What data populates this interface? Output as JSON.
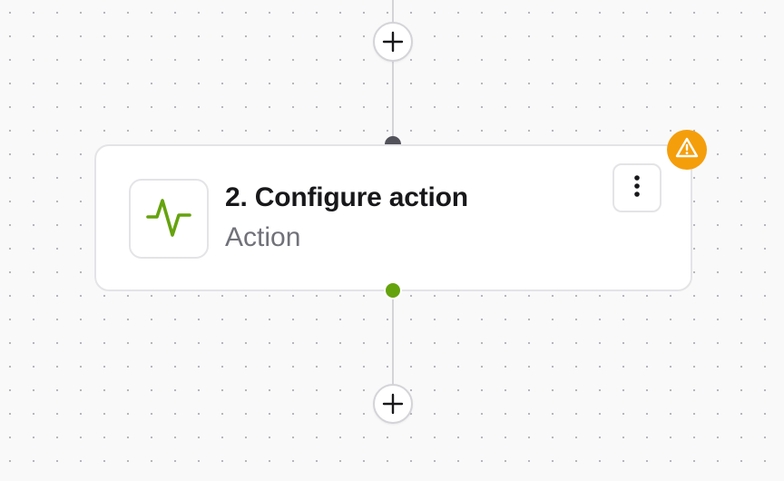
{
  "node": {
    "title": "2. Configure action",
    "subtitle": "Action",
    "icon": "activity-pulse-icon",
    "status": "warning"
  },
  "controls": {
    "add_step_icon": "plus-icon",
    "menu_icon": "more-vertical-icon",
    "warning_icon": "alert-triangle-icon"
  },
  "colors": {
    "canvas_background": "#f9f9fa",
    "canvas_dots": "#b3b3ba",
    "connector": "#d4d4d8",
    "node_border": "#e4e4e7",
    "title_text": "#18181b",
    "subtitle_text": "#71717a",
    "action_icon": "#65a30d",
    "output_handle": "#65a30d",
    "input_handle": "#52525b",
    "warning_badge": "#f59e0b"
  }
}
